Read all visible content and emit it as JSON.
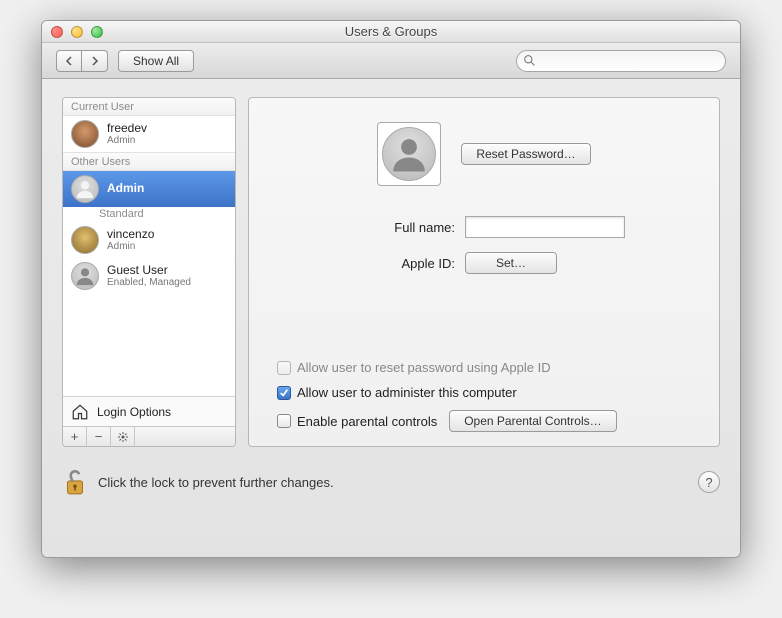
{
  "window": {
    "title": "Users & Groups"
  },
  "toolbar": {
    "show_all": "Show All",
    "search_placeholder": ""
  },
  "sidebar": {
    "current_header": "Current User",
    "other_header": "Other Users",
    "current": {
      "name": "freedev",
      "role": "Admin"
    },
    "others": [
      {
        "name": "Admin",
        "role": ""
      },
      {
        "name": "Standard",
        "role": "",
        "is_header": true
      },
      {
        "name": "vincenzo",
        "role": "Admin"
      },
      {
        "name": "Guest User",
        "role": "Enabled, Managed"
      }
    ],
    "login_options": "Login Options"
  },
  "main": {
    "reset_password": "Reset Password…",
    "fullname_label": "Full name:",
    "fullname_value": "",
    "appleid_label": "Apple ID:",
    "appleid_set": "Set…",
    "chk_reset_appleid": "Allow user to reset password using Apple ID",
    "chk_admin": "Allow user to administer this computer",
    "chk_parental": "Enable parental controls",
    "open_parental": "Open Parental Controls…"
  },
  "footer": {
    "lock_tip": "Click the lock to prevent further changes."
  }
}
